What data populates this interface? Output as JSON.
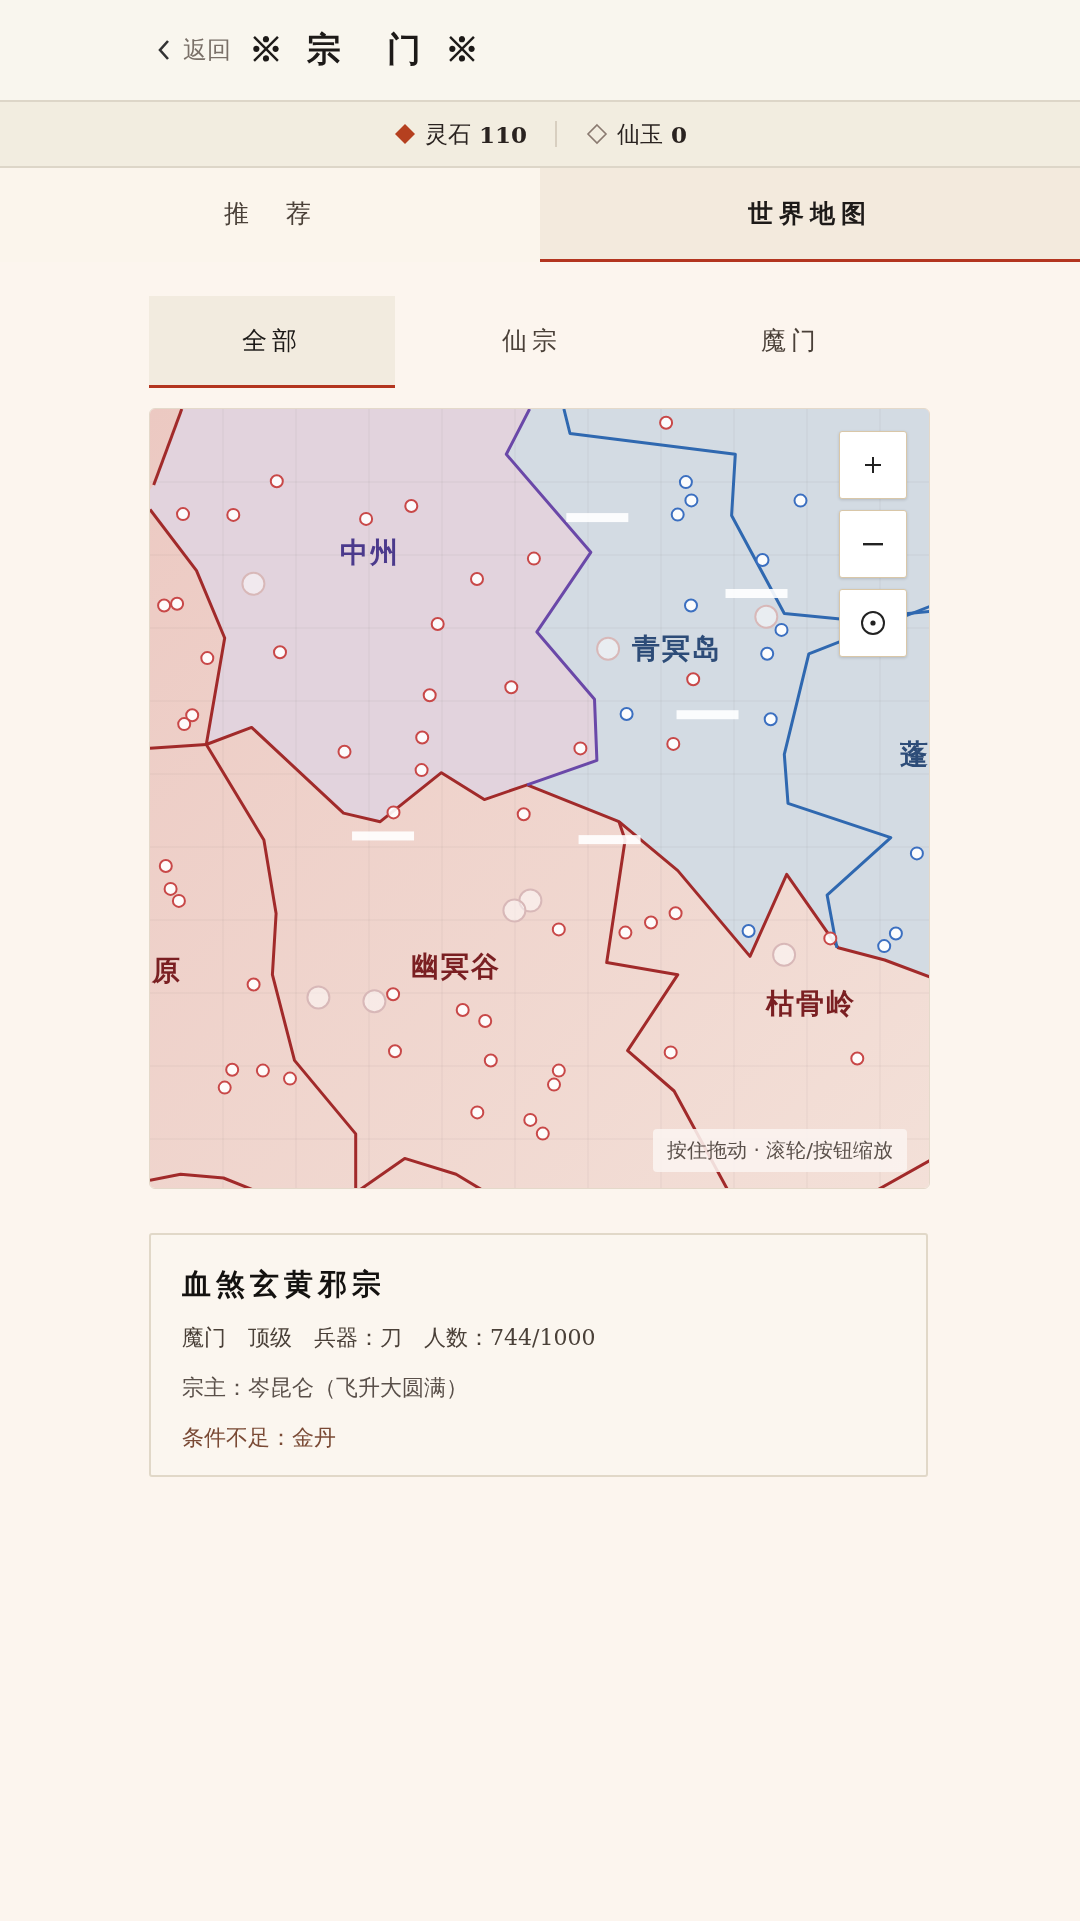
{
  "header": {
    "back": "返回",
    "title": "※ 宗　门 ※"
  },
  "currency": [
    {
      "kind": "stone",
      "label": "灵石",
      "amount": "110"
    },
    {
      "kind": "jade",
      "label": "仙玉",
      "amount": "0"
    }
  ],
  "main_tabs": [
    {
      "label": "推　荐",
      "selected": false
    },
    {
      "label": "世界地图",
      "selected": true
    }
  ],
  "filter_tabs": [
    {
      "label": "全部",
      "selected": true
    },
    {
      "label": "仙宗",
      "selected": false
    },
    {
      "label": "魔门",
      "selected": false
    }
  ],
  "map": {
    "regions": [
      {
        "name": "中州",
        "color": "#4b3a8c"
      },
      {
        "name": "青冥岛",
        "color": "#2d4c78"
      },
      {
        "name": "蓬",
        "color": "#2d4c78"
      },
      {
        "name": "幽冥谷",
        "color": "#7a1f22"
      },
      {
        "name": "枯骨岭",
        "color": "#7a1f22"
      },
      {
        "name": "原",
        "color": "#7a1f22"
      }
    ],
    "hint": "按住拖动 · 滚轮/按钮缩放"
  },
  "sect": {
    "name": "血煞玄黄邪宗",
    "stats": [
      "魔门",
      "顶级",
      "兵器：刀",
      "人数：744/1000"
    ],
    "leader": "宗主：岑昆仑（飞升大圆满）",
    "requirement": "条件不足：金丹"
  }
}
